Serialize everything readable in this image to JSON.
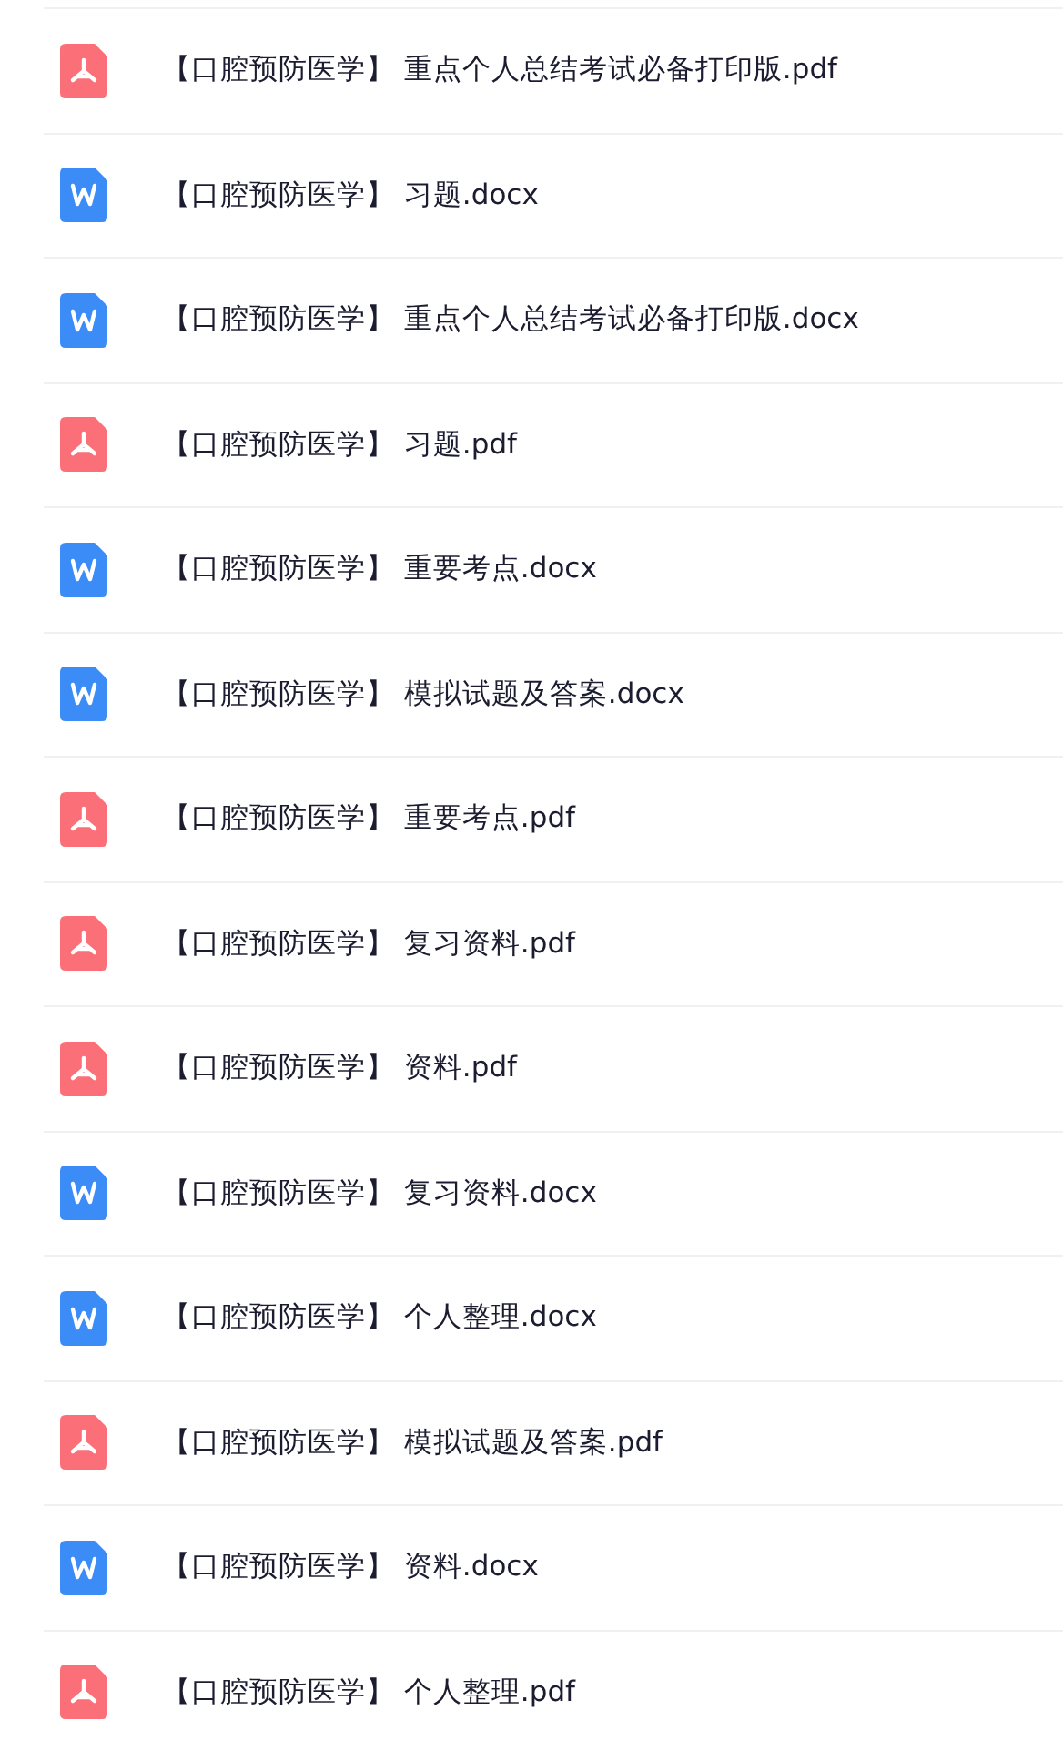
{
  "files": [
    {
      "kind": "pdf",
      "name": "【口腔预防医学】 重点个人总结考试必备打印版.pdf"
    },
    {
      "kind": "docx",
      "name": "【口腔预防医学】 习题.docx"
    },
    {
      "kind": "docx",
      "name": "【口腔预防医学】 重点个人总结考试必备打印版.docx"
    },
    {
      "kind": "pdf",
      "name": "【口腔预防医学】 习题.pdf"
    },
    {
      "kind": "docx",
      "name": "【口腔预防医学】 重要考点.docx"
    },
    {
      "kind": "docx",
      "name": "【口腔预防医学】 模拟试题及答案.docx"
    },
    {
      "kind": "pdf",
      "name": "【口腔预防医学】 重要考点.pdf"
    },
    {
      "kind": "pdf",
      "name": "【口腔预防医学】 复习资料.pdf"
    },
    {
      "kind": "pdf",
      "name": "【口腔预防医学】 资料.pdf"
    },
    {
      "kind": "docx",
      "name": "【口腔预防医学】 复习资料.docx"
    },
    {
      "kind": "docx",
      "name": "【口腔预防医学】 个人整理.docx"
    },
    {
      "kind": "pdf",
      "name": "【口腔预防医学】 模拟试题及答案.pdf"
    },
    {
      "kind": "docx",
      "name": "【口腔预防医学】 资料.docx"
    },
    {
      "kind": "pdf",
      "name": "【口腔预防医学】 个人整理.pdf"
    }
  ]
}
